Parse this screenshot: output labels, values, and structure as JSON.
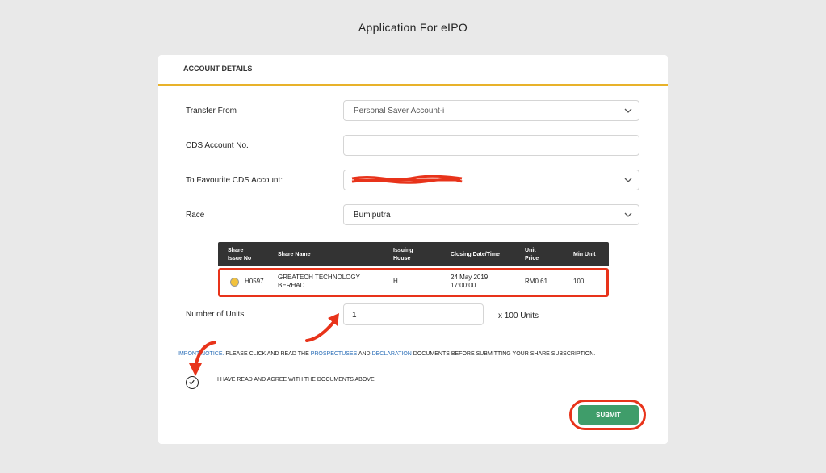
{
  "page": {
    "title": "Application For eIPO"
  },
  "card": {
    "section_title": "ACCOUNT DETAILS"
  },
  "form": {
    "transfer_from": {
      "label": "Transfer From",
      "value": "Personal Saver Account-i"
    },
    "cds_account": {
      "label": "CDS Account No.",
      "value": ""
    },
    "favourite_cds": {
      "label": "To Favourite CDS Account:",
      "value": ""
    },
    "race": {
      "label": "Race",
      "value": "Bumiputra"
    },
    "units": {
      "label": "Number of Units",
      "value": "1",
      "suffix": "x 100 Units"
    }
  },
  "table": {
    "headers": {
      "share_issue_no_1": "Share",
      "share_issue_no_2": "Issue No",
      "share_name": "Share Name",
      "issuing_house_1": "Issuing",
      "issuing_house_2": "House",
      "closing": "Closing Date/Time",
      "unit_price_1": "Unit",
      "unit_price_2": "Price",
      "min_unit": "Min Unit"
    },
    "row": {
      "issue_no": "H0597",
      "share_name_1": "GREATECH TECHNOLOGY",
      "share_name_2": "BERHAD",
      "issuing_house": "H",
      "closing_date": "24 May 2019",
      "closing_time": "17:00:00",
      "unit_price": "RM0.61",
      "min_unit": "100"
    }
  },
  "notice": {
    "prefix": "IMPO",
    "link1": "NT NOTICE.",
    "text1": " PLEASE CLICK AND READ THE ",
    "link2": "PROSPECTUSES",
    "text2": " AND ",
    "link3": "DECLARATION",
    "text3": " DOCUMENTS BEFORE SUBMITTING YOUR SHARE SUBSCRIPTION."
  },
  "agreement": {
    "label": "I HAVE READ AND AGREE WITH THE DOCUMENTS ABOVE."
  },
  "actions": {
    "submit_label": "SUBMIT"
  },
  "colors": {
    "accent": "#e8b22a",
    "submit": "#3f9d6a",
    "annotation": "#e8331a",
    "link": "#2c6fb8"
  }
}
